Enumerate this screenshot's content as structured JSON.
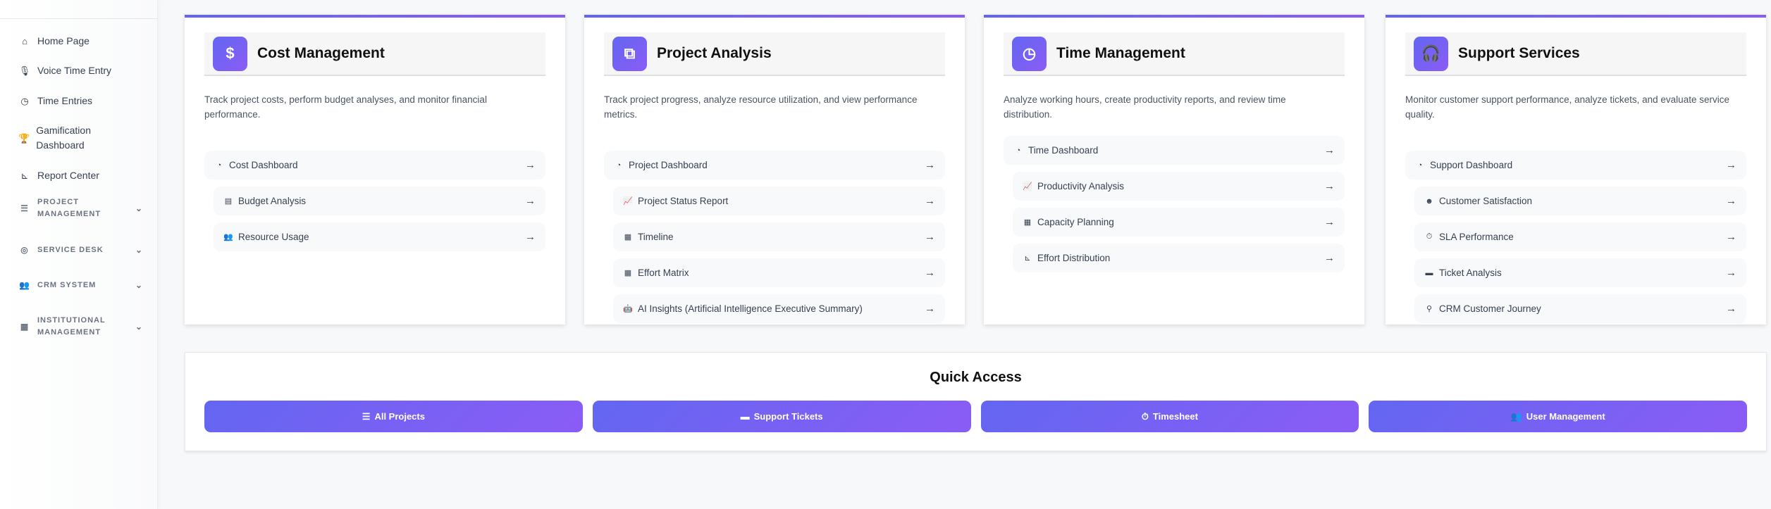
{
  "sidebar": {
    "items": [
      {
        "label": "Home Page",
        "icon": "⌂"
      },
      {
        "label": "Voice Time Entry",
        "icon": "🎙"
      },
      {
        "label": "Time Entries",
        "icon": "◷"
      },
      {
        "label": "Gamification Dashboard",
        "icon": "🏆"
      },
      {
        "label": "Report Center",
        "icon": "⊾"
      }
    ],
    "sections": [
      {
        "label": "Project Management",
        "icon": "☰"
      },
      {
        "label": "Service Desk",
        "icon": "◎"
      },
      {
        "label": "CRM System",
        "icon": "👥"
      },
      {
        "label": "Institutional Management",
        "icon": "▦"
      }
    ]
  },
  "cards": [
    {
      "title": "Cost Management",
      "icon": "$",
      "description": "Track project costs, perform budget analyses, and monitor financial performance.",
      "items": [
        {
          "label": "Cost Dashboard",
          "icon": "◔"
        },
        {
          "label": "Budget Analysis",
          "icon": "▤"
        },
        {
          "label": "Resource Usage",
          "icon": "👥"
        }
      ]
    },
    {
      "title": "Project Analysis",
      "icon": "⧉",
      "description": "Track project progress, analyze resource utilization, and view performance metrics.",
      "items": [
        {
          "label": "Project Dashboard",
          "icon": "◔"
        },
        {
          "label": "Project Status Report",
          "icon": "📈"
        },
        {
          "label": "Timeline",
          "icon": "▦"
        },
        {
          "label": "Effort Matrix",
          "icon": "▦"
        },
        {
          "label": "AI Insights (Artificial Intelligence Executive Summary)",
          "icon": "🤖"
        }
      ]
    },
    {
      "title": "Time Management",
      "icon": "◷",
      "description": "Analyze working hours, create productivity reports, and review time distribution.",
      "items": [
        {
          "label": "Time Dashboard",
          "icon": "◔"
        },
        {
          "label": "Productivity Analysis",
          "icon": "📈"
        },
        {
          "label": "Capacity Planning",
          "icon": "▦"
        },
        {
          "label": "Effort Distribution",
          "icon": "⊾"
        }
      ]
    },
    {
      "title": "Support Services",
      "icon": "🎧",
      "description": "Monitor customer support performance, analyze tickets, and evaluate service quality.",
      "items": [
        {
          "label": "Support Dashboard",
          "icon": "◔"
        },
        {
          "label": "Customer Satisfaction",
          "icon": "☻"
        },
        {
          "label": "SLA Performance",
          "icon": "⏱"
        },
        {
          "label": "Ticket Analysis",
          "icon": "▬"
        },
        {
          "label": "CRM Customer Journey",
          "icon": "⚲"
        }
      ]
    }
  ],
  "quick_access": {
    "title": "Quick Access",
    "buttons": [
      {
        "label": "All Projects",
        "icon": "☰"
      },
      {
        "label": "Support Tickets",
        "icon": "▬"
      },
      {
        "label": "Timesheet",
        "icon": "⏱"
      },
      {
        "label": "User Management",
        "icon": "👥"
      }
    ]
  },
  "arrow": "→",
  "chevron": "⌄"
}
